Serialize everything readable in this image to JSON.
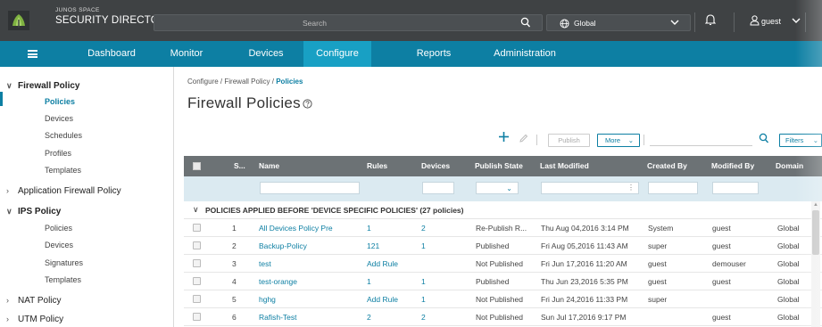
{
  "header": {
    "brand_line1": "JUNOS SPACE",
    "brand_line2": "SECURITY DIRECTOR",
    "search_placeholder": "Search",
    "domain": "Global",
    "user": "guest"
  },
  "nav": {
    "items": [
      {
        "label": "Dashboard",
        "active": false
      },
      {
        "label": "Monitor",
        "active": false
      },
      {
        "label": "Devices",
        "active": false
      },
      {
        "label": "Configure",
        "active": true
      },
      {
        "label": "Reports",
        "active": false
      },
      {
        "label": "Administration",
        "active": false
      }
    ]
  },
  "sidebar": {
    "firewall_policy": "Firewall Policy",
    "fw_policies": "Policies",
    "fw_devices": "Devices",
    "fw_schedules": "Schedules",
    "fw_profiles": "Profiles",
    "fw_templates": "Templates",
    "application_firewall_policy": "Application Firewall Policy",
    "ips_policy": "IPS Policy",
    "ips_policies": "Policies",
    "ips_devices": "Devices",
    "ips_signatures": "Signatures",
    "ips_templates": "Templates",
    "nat_policy": "NAT Policy",
    "utm_policy": "UTM Policy"
  },
  "breadcrumb": {
    "part1": "Configure",
    "sep": "/",
    "part2": "Firewall Policy",
    "part3": "Policies"
  },
  "page": {
    "title": "Firewall Policies"
  },
  "toolbar": {
    "publish": "Publish",
    "more": "More",
    "filters": "Filters"
  },
  "table": {
    "columns": [
      "S...",
      "Name",
      "Rules",
      "Devices",
      "Publish State",
      "Last Modified",
      "Created By",
      "Modified By",
      "Domain"
    ],
    "group_label": "POLICIES APPLIED BEFORE 'DEVICE SPECIFIC POLICIES' (27 policies)",
    "rows": [
      {
        "seq": "1",
        "name": "All Devices Policy Pre",
        "rules": "1",
        "devices": "2",
        "state": "Re-Publish R...",
        "modified": "Thu Aug 04,2016 3:14 PM",
        "created_by": "System",
        "modified_by": "guest",
        "domain": "Global"
      },
      {
        "seq": "2",
        "name": "Backup-Policy",
        "rules": "121",
        "devices": "1",
        "state": "Published",
        "modified": "Fri Aug 05,2016 11:43 AM",
        "created_by": "super",
        "modified_by": "guest",
        "domain": "Global"
      },
      {
        "seq": "3",
        "name": "test",
        "rules": "Add Rule",
        "devices": "",
        "state": "Not Published",
        "modified": "Fri Jun 17,2016 11:20 AM",
        "created_by": "guest",
        "modified_by": "demouser",
        "domain": "Global"
      },
      {
        "seq": "4",
        "name": "test-orange",
        "rules": "1",
        "devices": "1",
        "state": "Published",
        "modified": "Thu Jun 23,2016 5:35 PM",
        "created_by": "guest",
        "modified_by": "guest",
        "domain": "Global"
      },
      {
        "seq": "5",
        "name": "hghg",
        "rules": "Add Rule",
        "devices": "1",
        "state": "Not Published",
        "modified": "Fri Jun 24,2016 11:33 PM",
        "created_by": "super",
        "modified_by": "",
        "domain": "Global"
      },
      {
        "seq": "6",
        "name": "Rafish-Test",
        "rules": "2",
        "devices": "2",
        "state": "Not Published",
        "modified": "Sun Jul 17,2016 9:17 PM",
        "created_by": "",
        "modified_by": "guest",
        "domain": "Global"
      }
    ]
  },
  "colors": {
    "header_bg": "#3f4244",
    "nav_bg": "#0d7fa3",
    "nav_active": "#18a0c4",
    "link": "#0d7fa3",
    "table_header": "#6c7275",
    "filter_row": "#dbeaf1"
  }
}
